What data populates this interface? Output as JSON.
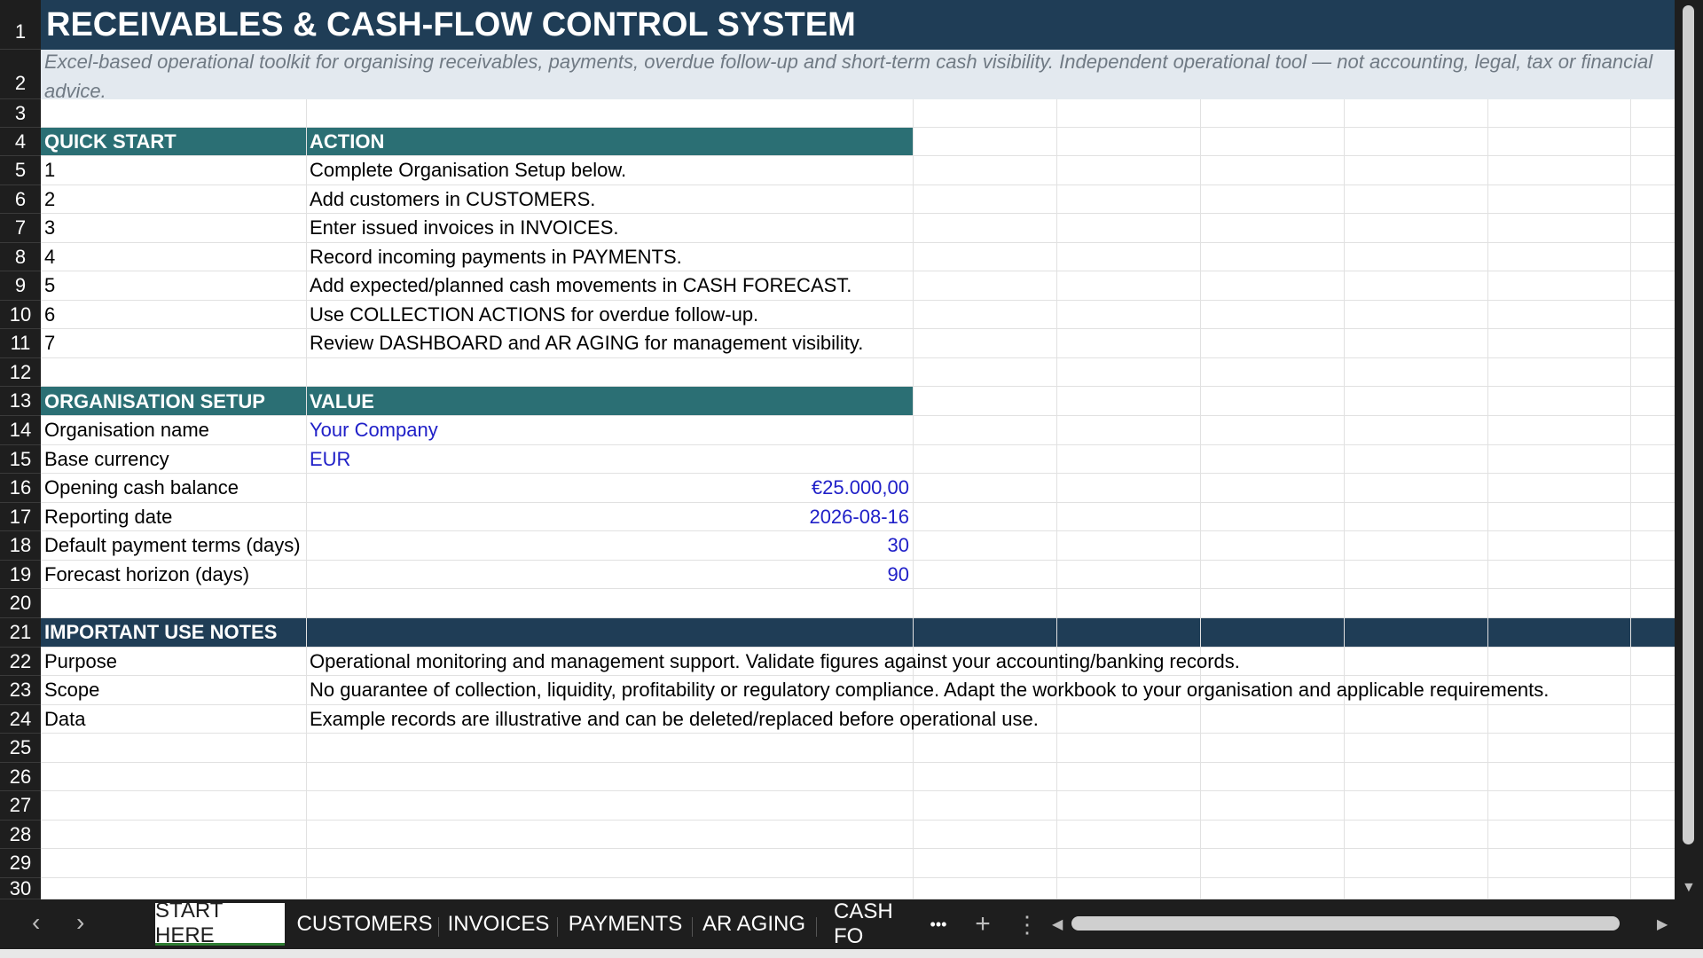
{
  "title": "RECEIVABLES & CASH-FLOW CONTROL SYSTEM",
  "subtitle": "Excel-based operational toolkit for organising receivables, payments, overdue follow-up and short-term cash visibility. Independent operational tool — not accounting, legal, tax or financial advice.",
  "row_numbers": [
    "1",
    "2",
    "3",
    "4",
    "5",
    "6",
    "7",
    "8",
    "9",
    "10",
    "11",
    "12",
    "13",
    "14",
    "15",
    "16",
    "17",
    "18",
    "19",
    "20",
    "21",
    "22",
    "23",
    "24",
    "25",
    "26",
    "27",
    "28",
    "29",
    "30"
  ],
  "quick_start": {
    "header_a": "QUICK START",
    "header_b": "ACTION",
    "steps": [
      {
        "n": "1",
        "action": "Complete Organisation Setup below."
      },
      {
        "n": "2",
        "action": "Add customers in CUSTOMERS."
      },
      {
        "n": "3",
        "action": "Enter issued invoices in INVOICES."
      },
      {
        "n": "4",
        "action": "Record incoming payments in PAYMENTS."
      },
      {
        "n": "5",
        "action": "Add expected/planned cash movements in CASH FORECAST."
      },
      {
        "n": "6",
        "action": "Use COLLECTION ACTIONS for overdue follow-up."
      },
      {
        "n": "7",
        "action": "Review DASHBOARD and AR AGING for management visibility."
      }
    ]
  },
  "org_setup": {
    "header_a": "ORGANISATION SETUP",
    "header_b": "VALUE",
    "rows": [
      {
        "label": "Organisation name",
        "value": "Your Company"
      },
      {
        "label": "Base currency",
        "value": "EUR"
      },
      {
        "label": "Opening cash balance",
        "value": "€25.000,00"
      },
      {
        "label": "Reporting date",
        "value": "2026-08-16"
      },
      {
        "label": "Default payment terms (days)",
        "value": "30"
      },
      {
        "label": "Forecast horizon (days)",
        "value": "90"
      }
    ]
  },
  "notes": {
    "header": "IMPORTANT USE NOTES",
    "rows": [
      {
        "label": "Purpose",
        "text": "Operational monitoring and management support. Validate figures against your accounting/banking records."
      },
      {
        "label": "Scope",
        "text": "No guarantee of collection, liquidity, profitability or regulatory compliance. Adapt the workbook to your organisation and applicable requirements."
      },
      {
        "label": "Data",
        "text": "Example records are illustrative and can be deleted/replaced before operational use."
      }
    ]
  },
  "tabs": [
    "START HERE",
    "CUSTOMERS",
    "INVOICES",
    "PAYMENTS",
    "AR AGING",
    "CASH FO"
  ],
  "more_tabs_glyph": "•••",
  "add_sheet_glyph": "+",
  "menu_glyph": "⋮",
  "nav_prev_glyph": "‹",
  "nav_next_glyph": "›",
  "colors": {
    "title_bg": "#1f3d56",
    "section_teal": "#2b6f74",
    "input_blue": "#2020c8"
  }
}
